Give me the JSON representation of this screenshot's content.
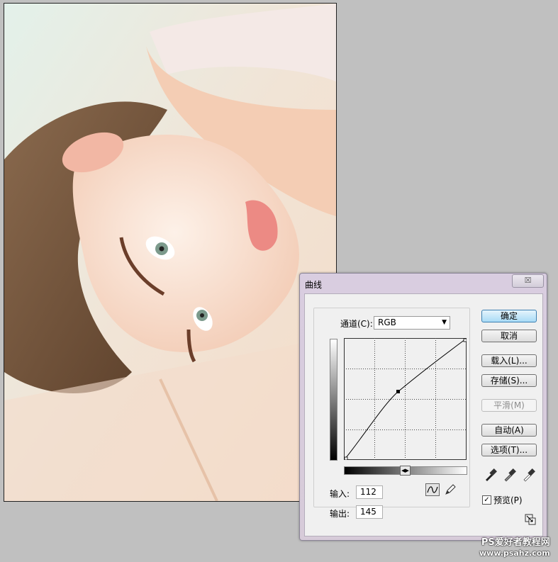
{
  "dialog": {
    "title": "曲线",
    "close_symbol": "☒",
    "channel_label": "通道(C):",
    "channel_value": "RGB",
    "input_label": "输入:",
    "input_value": "112",
    "output_label": "输出:",
    "output_value": "145",
    "buttons": {
      "ok": "确定",
      "cancel": "取消",
      "load": "载入(L)...",
      "save": "存储(S)...",
      "smooth": "平滑(M)",
      "auto": "自动(A)",
      "options": "选项(T)..."
    },
    "preview_label": "预览(P)",
    "preview_checked": true,
    "curve_point": {
      "input": 112,
      "output": 145
    },
    "icons": [
      "curve-tool-icon",
      "pencil-tool-icon",
      "black-eyedropper-icon",
      "gray-eyedropper-icon",
      "white-eyedropper-icon",
      "resize-icon"
    ]
  },
  "watermark": {
    "line1": "PS爱好者教程网",
    "line2": "www.psahz.com"
  },
  "colors": {
    "accent": "#a9dbf6",
    "background": "#c0c0c0"
  }
}
